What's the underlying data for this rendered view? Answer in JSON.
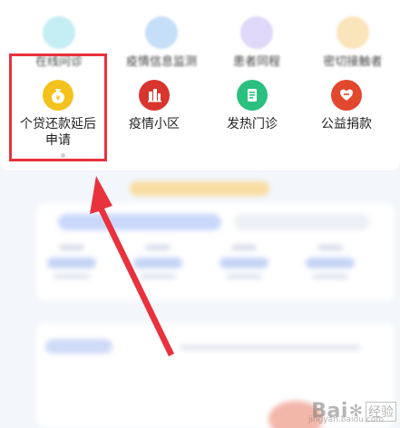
{
  "services_row1": [
    {
      "label": "在线问诊",
      "icon": "consult-icon",
      "color": "#7ed6e6"
    },
    {
      "label": "疫情信息监测",
      "icon": "monitor-icon",
      "color": "#7fb8f0"
    },
    {
      "label": "患者同程",
      "icon": "patient-icon",
      "color": "#b7a8ef"
    },
    {
      "label": "密切接触者",
      "icon": "contact-icon",
      "color": "#f5c46b"
    }
  ],
  "services_row2": [
    {
      "label_line1": "个贷还款延后",
      "label_line2": "申请",
      "icon": "money-bag-icon",
      "color": "#f4c21d"
    },
    {
      "label": "疫情小区",
      "icon": "community-building-icon",
      "color": "#d9352f"
    },
    {
      "label": "发热门诊",
      "icon": "clinic-icon",
      "color": "#2bc07f"
    },
    {
      "label": "公益捐款",
      "icon": "heart-donate-icon",
      "color": "#e2482e"
    }
  ],
  "highlight_color": "#e8323e",
  "watermark": {
    "text": "Bai",
    "cn": "经验",
    "sub": "jingyan.baidu.com"
  }
}
